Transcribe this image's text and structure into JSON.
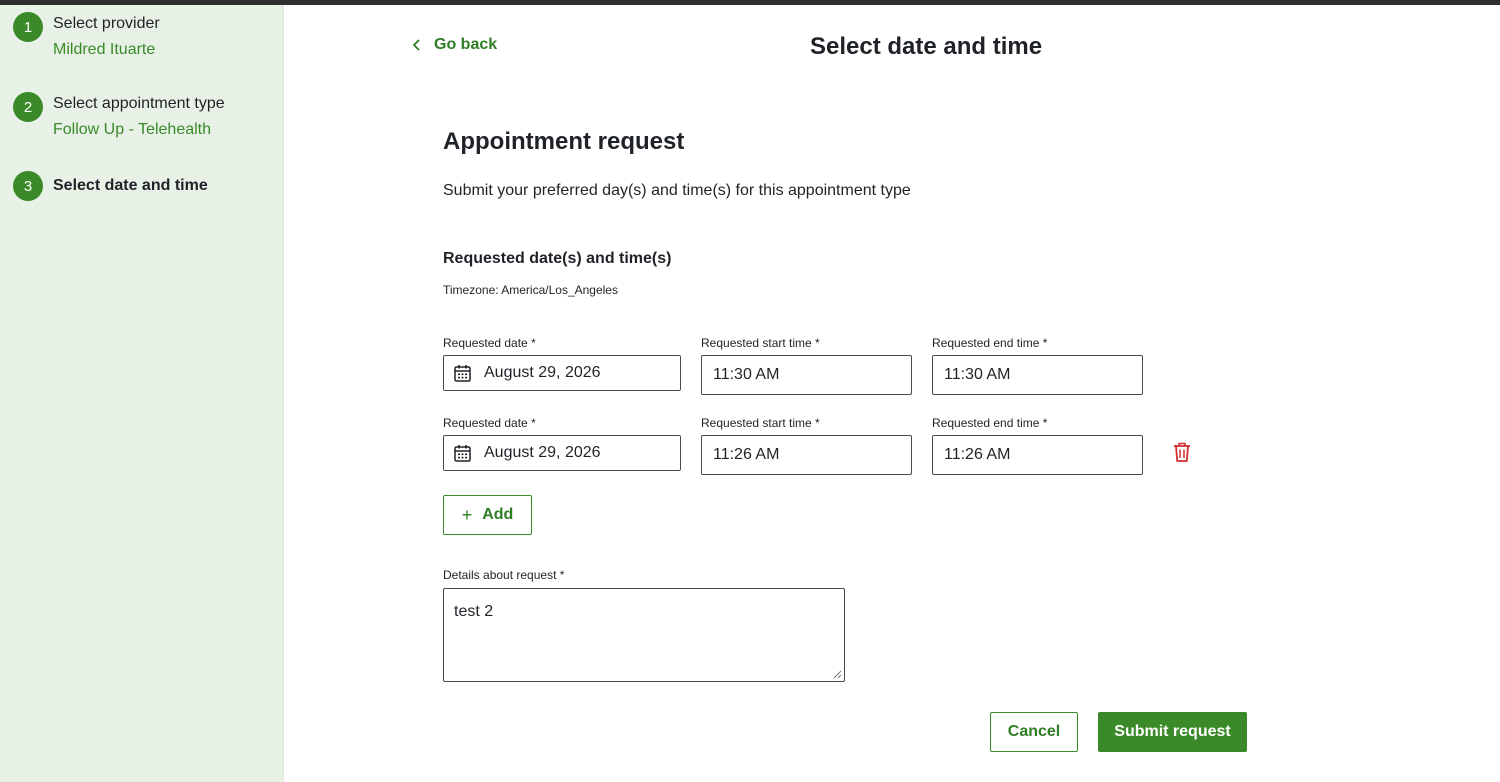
{
  "sidebar": {
    "steps": [
      {
        "number": "1",
        "title": "Select provider",
        "subtitle": "Mildred Ituarte"
      },
      {
        "number": "2",
        "title": "Select appointment type",
        "subtitle": "Follow Up - Telehealth"
      },
      {
        "number": "3",
        "title": "Select date and time"
      }
    ]
  },
  "header": {
    "back_label": "Go back",
    "title": "Select date and time"
  },
  "form": {
    "heading": "Appointment request",
    "description": "Submit your preferred day(s) and time(s) for this appointment type",
    "requested_heading": "Requested date(s) and time(s)",
    "timezone": "Timezone: America/Los_Angeles",
    "rows": [
      {
        "date_label": "Requested date *",
        "date_value": "August 29, 2026",
        "start_label": "Requested start time *",
        "start_value": "11:30 AM",
        "end_label": "Requested end time *",
        "end_value": "11:30 AM"
      },
      {
        "date_label": "Requested date *",
        "date_value": "August 29, 2026",
        "start_label": "Requested start time *",
        "start_value": "11:26 AM",
        "end_label": "Requested end time *",
        "end_value": "11:26 AM"
      }
    ],
    "add_label": "Add",
    "add_symbol": "+",
    "details_label": "Details about request *",
    "details_value": "test 2",
    "cancel_label": "Cancel",
    "submit_label": "Submit request"
  },
  "colors": {
    "accent": "#3a8a2a",
    "sidebar_bg": "#e8f1e6",
    "delete": "#d32f2f"
  }
}
